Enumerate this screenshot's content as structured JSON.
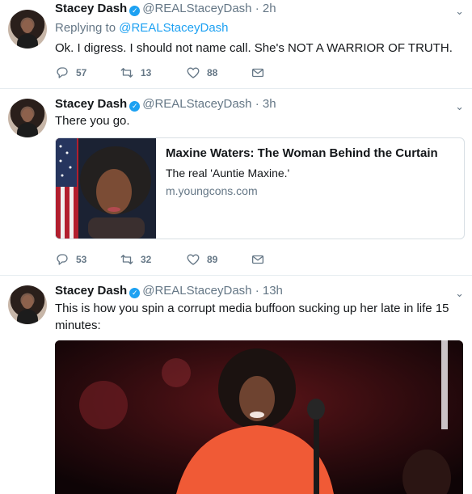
{
  "tweets": [
    {
      "name": "Stacey Dash",
      "handle": "@REALStaceyDash",
      "separator": "·",
      "time": "2h",
      "replying_prefix": "Replying to",
      "replying_handle": "@REALStaceyDash",
      "text": "Ok. I digress. I should not name call.  She's NOT A WARRIOR OF TRUTH.",
      "replies": "57",
      "retweets": "13",
      "likes": "88"
    },
    {
      "name": "Stacey Dash",
      "handle": "@REALStaceyDash",
      "separator": "·",
      "time": "3h",
      "text": "There you go.",
      "card": {
        "title": "Maxine Waters: The Woman Behind the Curtain",
        "description": "The real 'Auntie Maxine.'",
        "domain": "m.youngcons.com"
      },
      "replies": "53",
      "retweets": "32",
      "likes": "89"
    },
    {
      "name": "Stacey Dash",
      "handle": "@REALStaceyDash",
      "separator": "·",
      "time": "13h",
      "text": "This is how you spin a corrupt media buffoon sucking up her late in life 15 minutes:"
    }
  ],
  "icons": {
    "verified": "verified-badge-icon",
    "caret": "chevron-down-icon",
    "reply": "reply-icon",
    "retweet": "retweet-icon",
    "like": "heart-icon",
    "message": "envelope-icon"
  },
  "colors": {
    "link": "#1da1f2",
    "muted": "#657786",
    "text": "#14171a",
    "border": "#e6ecf0"
  }
}
